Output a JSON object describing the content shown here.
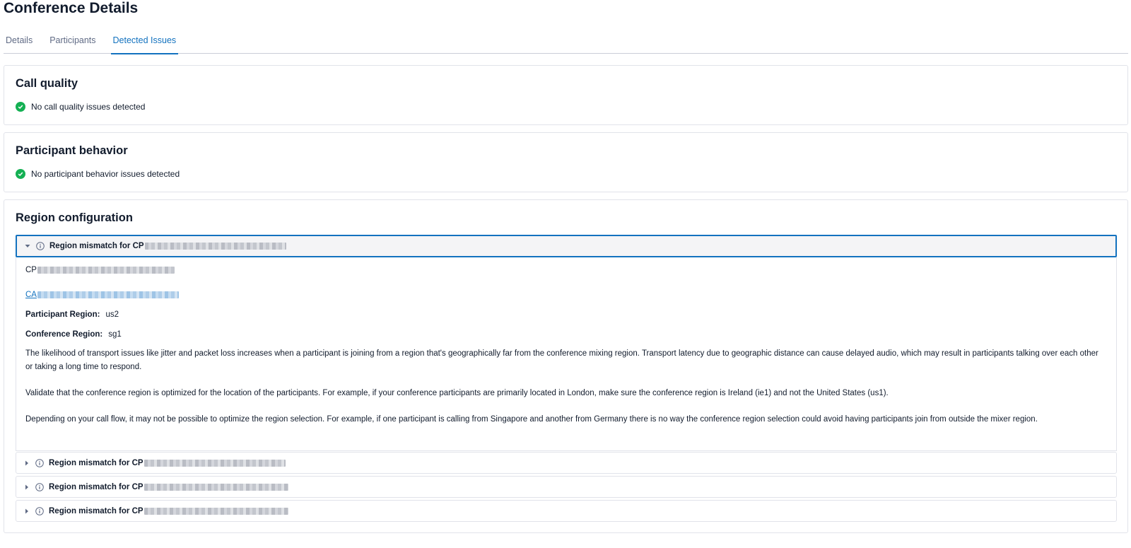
{
  "page_title": "Conference Details",
  "tabs": [
    {
      "label": "Details"
    },
    {
      "label": "Participants"
    },
    {
      "label": "Detected Issues"
    }
  ],
  "call_quality": {
    "title": "Call quality",
    "status": "No call quality issues detected"
  },
  "participant_behavior": {
    "title": "Participant behavior",
    "status": "No participant behavior issues detected"
  },
  "region_configuration": {
    "title": "Region configuration",
    "issues": [
      {
        "label": "Region mismatch for CP",
        "expanded": true
      },
      {
        "label": "Region mismatch for CP",
        "expanded": false
      },
      {
        "label": "Region mismatch for CP",
        "expanded": false
      },
      {
        "label": "Region mismatch for CP",
        "expanded": false
      }
    ],
    "detail": {
      "participant_sid_prefix": "CP",
      "call_sid_prefix": "CA",
      "participant_region_label": "Participant Region:",
      "participant_region_value": "us2",
      "conference_region_label": "Conference Region:",
      "conference_region_value": "sg1",
      "paragraph_1": "The likelihood of transport issues like jitter and packet loss increases when a participant is joining from a region that's geographically far from the conference mixing region. Transport latency due to geographic distance can cause delayed audio, which may result in participants talking over each other or taking a long time to respond.",
      "paragraph_2": "Validate that the conference region is optimized for the location of the participants. For example, if your conference participants are primarily located in London, make sure the conference region is Ireland (ie1) and not the United States (us1).",
      "paragraph_3": "Depending on your call flow, it may not be possible to optimize the region selection. For example, if one participant is calling from Singapore and another from Germany there is no way the conference region selection could avoid having participants join from outside the mixer region."
    }
  },
  "colors": {
    "accent": "#1372bf",
    "success": "#14b053",
    "border": "#e1e3ea"
  }
}
